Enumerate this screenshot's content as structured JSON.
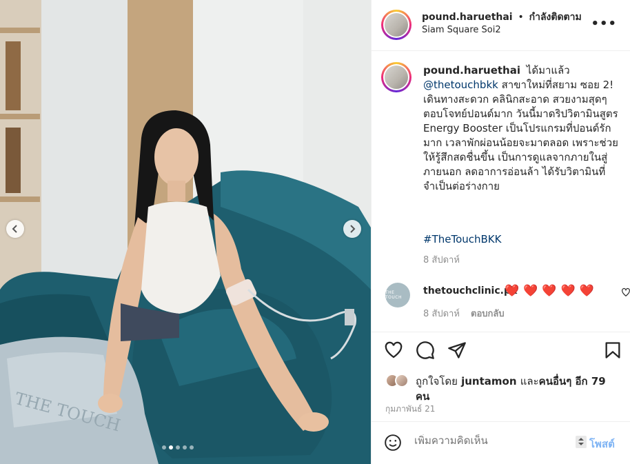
{
  "post": {
    "username": "pound.haruethai",
    "follow_separator": "•",
    "follow_status": "กำลังติดตาม",
    "location": "Siam Square Soi2",
    "more_label": "•••"
  },
  "photo": {
    "alt": "Woman in white top sitting on a teal velvet sofa receiving an IV vitamin drip",
    "carousel_dots": 5,
    "active_dot": 1,
    "blanket_text": "THE TOUCH"
  },
  "caption": {
    "username": "pound.haruethai",
    "text_before": "ได้มาแล้ว",
    "mention": "@thetouchbkk",
    "text_after": "สาขาใหม่ที่สยาม ซอย 2! เดินทางสะดวก คลินิกสะอาด สวยงามสุดๆ ตอบโจทย์ปอนด์มาก วันนี้มาดริปวิตามินสูตร Energy Booster เป็นโปรแกรมที่ปอนด์รักมาก เวลาพักผ่อนน้อยจะมาตลอด เพราะช่วยให้รู้สึกสดชื่นขึ้น เป็นการดูแลจากภายในสู่ภายนอก ลดอาการอ่อนล้า ได้รับวิตามินที่จำเป็นต่อร่างกาย",
    "hashtag": "#TheTouchBKK",
    "time": "8 สัปดาห์"
  },
  "comment": {
    "username": "thetouchclinic.pk",
    "avatar_text": "THE TOUCH",
    "text": "❤️❤️❤️❤️❤️",
    "time": "8 สัปดาห์",
    "reply_label": "ตอบกลับ"
  },
  "actions": {
    "like_icon": "heart-outline-icon",
    "comment_icon": "comment-bubble-icon",
    "share_icon": "paper-plane-icon",
    "save_icon": "bookmark-icon"
  },
  "likes": {
    "prefix": "ถูกใจโดย",
    "user": "juntamon",
    "middle": "และ",
    "others": "คนอื่นๆ อีก 79 คน"
  },
  "date": "กุมภาพันธ์ 21",
  "add_comment": {
    "placeholder": "เพิ่มความคิดเห็น",
    "post_label": "โพสต์"
  },
  "colors": {
    "link": "#00376b",
    "heart": "#e0243b",
    "post_button": "#7fb4f4",
    "sofa": "#1d5b6b"
  }
}
